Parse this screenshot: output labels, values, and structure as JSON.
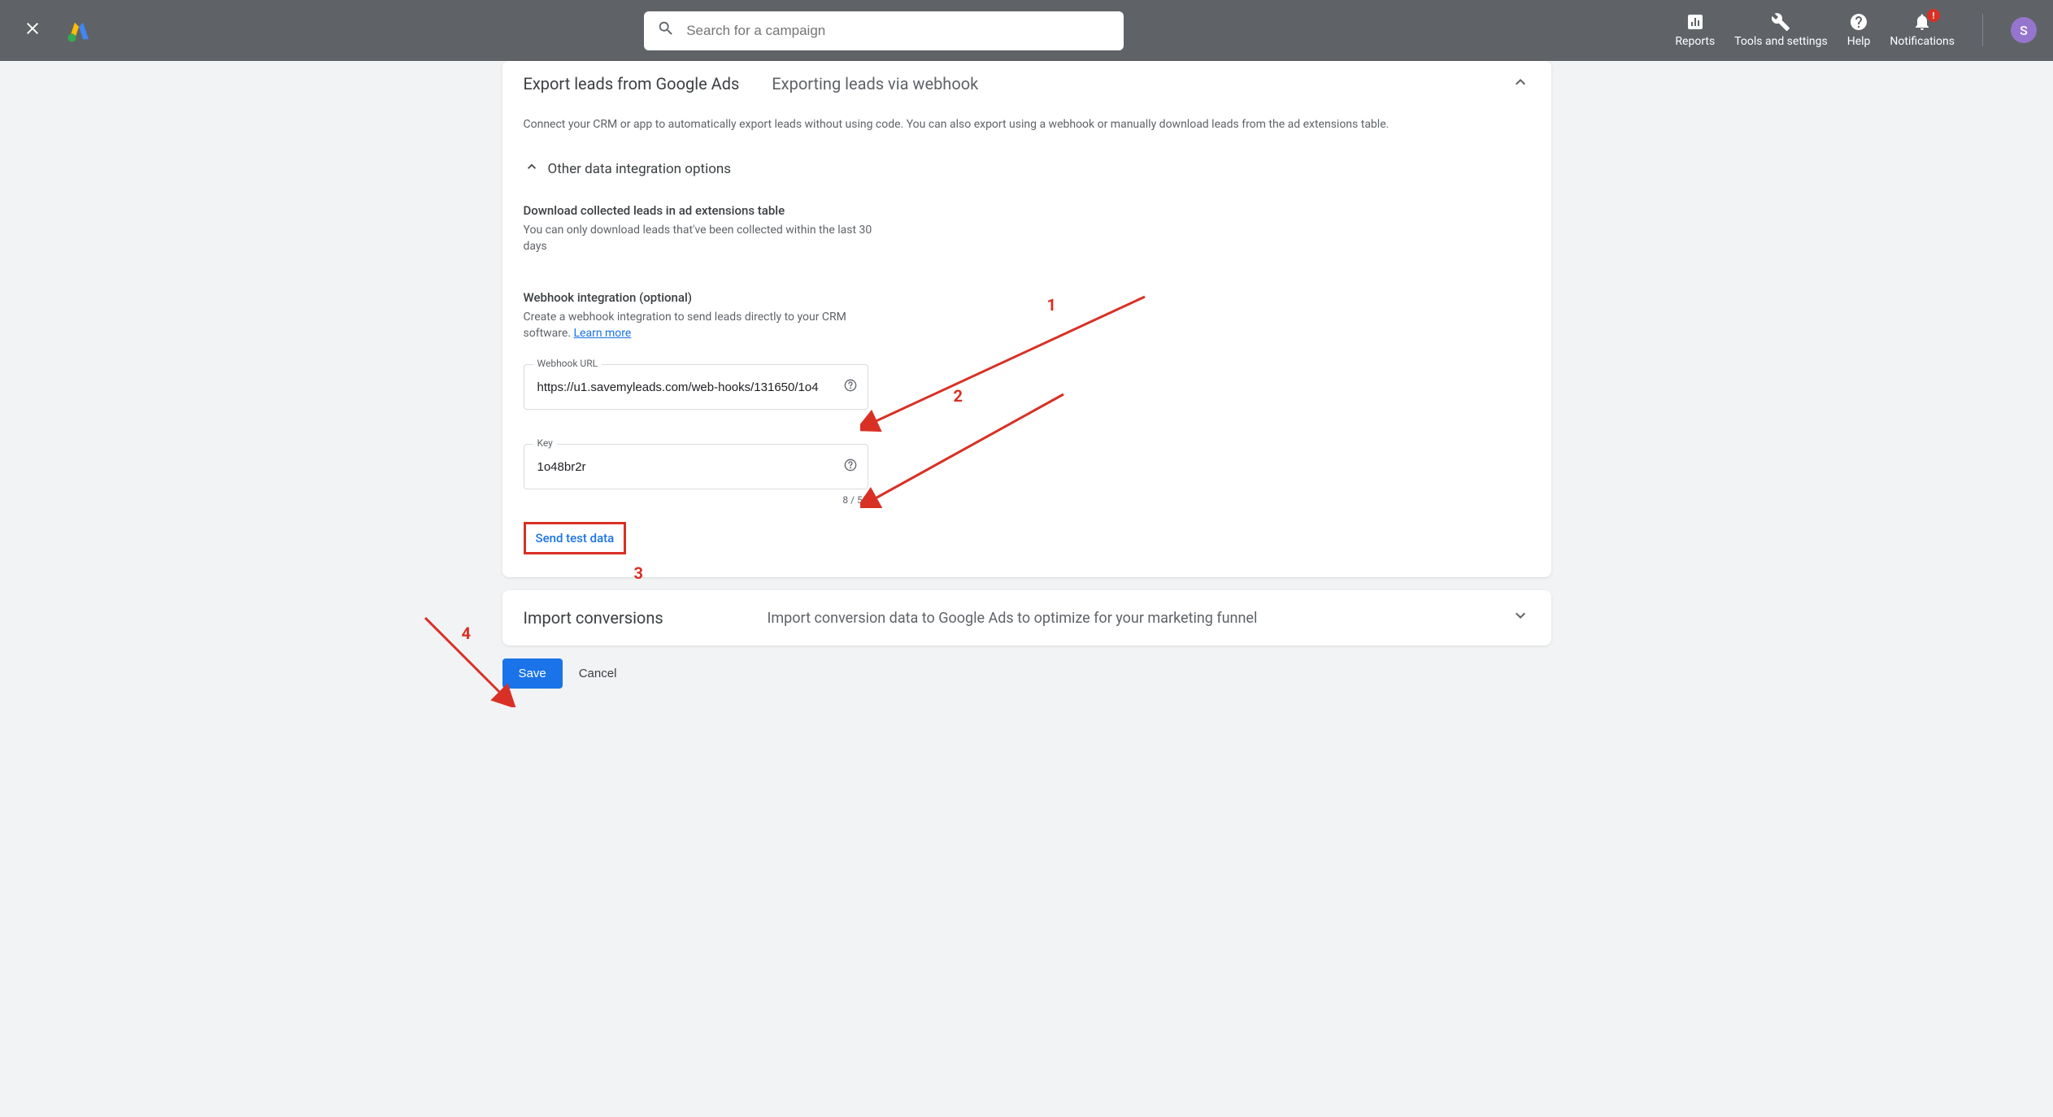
{
  "header": {
    "search_placeholder": "Search for a campaign",
    "actions": {
      "reports": "Reports",
      "tools": "Tools and settings",
      "help": "Help",
      "notifications": "Notifications",
      "notif_badge": "!"
    },
    "avatar_initial": "S"
  },
  "export_card": {
    "title": "Export leads from Google Ads",
    "subtitle": "Exporting leads via webhook",
    "description": "Connect your CRM or app to automatically export leads without using code. You can also export using a webhook or manually download leads from the ad extensions table.",
    "other_options_label": "Other data integration options",
    "download_section": {
      "title": "Download collected leads in ad extensions table",
      "desc": "You can only download leads that've been collected within the last 30 days"
    },
    "webhook_section": {
      "title": "Webhook integration (optional)",
      "desc": "Create a webhook integration to send leads directly to your CRM software. ",
      "learn_more": "Learn more",
      "url_label": "Webhook URL",
      "url_value": "https://u1.savemyleads.com/web-hooks/131650/1o4",
      "key_label": "Key",
      "key_value": "1o48br2r",
      "char_count": "8 / 50",
      "test_button": "Send test data"
    }
  },
  "import_card": {
    "title": "Import conversions",
    "desc": "Import conversion data to Google Ads to optimize for your marketing funnel"
  },
  "buttons": {
    "save": "Save",
    "cancel": "Cancel"
  },
  "annotations": {
    "n1": "1",
    "n2": "2",
    "n3": "3",
    "n4": "4"
  }
}
